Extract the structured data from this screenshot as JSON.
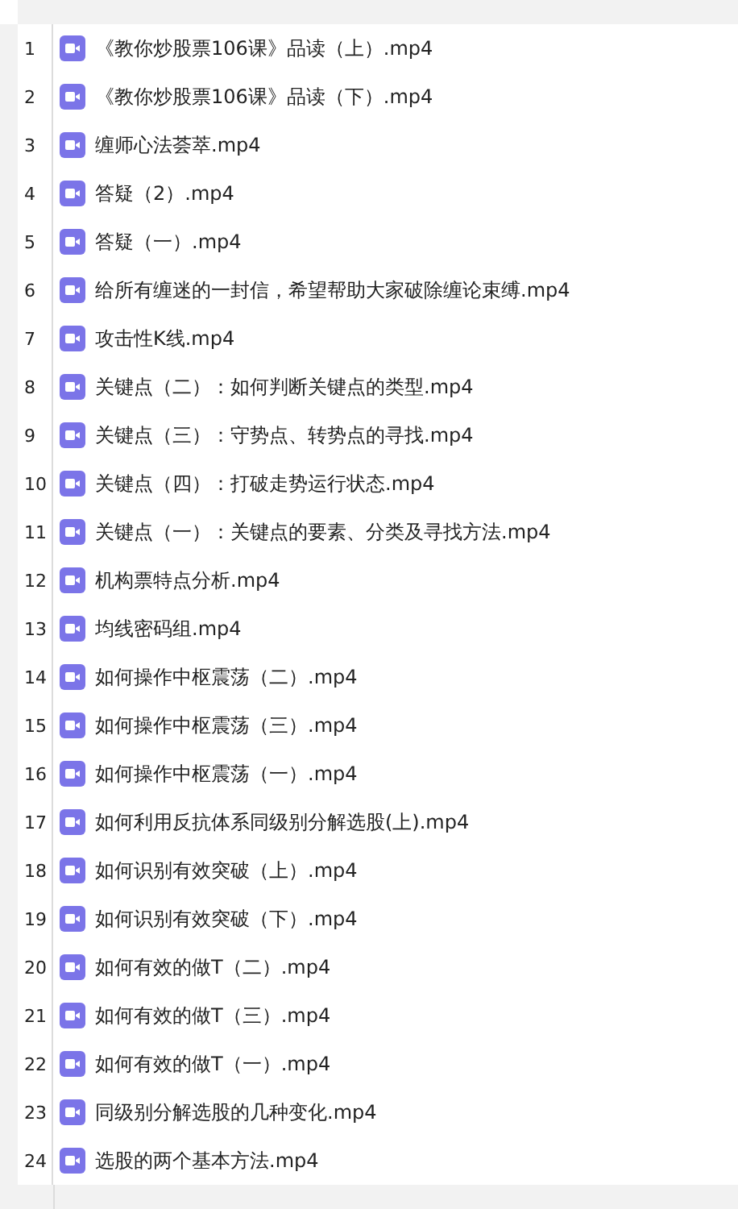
{
  "files": [
    {
      "number": "1",
      "name": "《教你炒股票106课》品读（上）.mp4"
    },
    {
      "number": "2",
      "name": "《教你炒股票106课》品读（下）.mp4"
    },
    {
      "number": "3",
      "name": "缠师心法荟萃.mp4"
    },
    {
      "number": "4",
      "name": "答疑（2）.mp4"
    },
    {
      "number": "5",
      "name": "答疑（一）.mp4"
    },
    {
      "number": "6",
      "name": "给所有缠迷的一封信，希望帮助大家破除缠论束缚.mp4"
    },
    {
      "number": "7",
      "name": "攻击性K线.mp4"
    },
    {
      "number": "8",
      "name": "关键点（二）：如何判断关键点的类型.mp4"
    },
    {
      "number": "9",
      "name": "关键点（三）：守势点、转势点的寻找.mp4"
    },
    {
      "number": "10",
      "name": "关键点（四）：打破走势运行状态.mp4"
    },
    {
      "number": "11",
      "name": "关键点（一）：关键点的要素、分类及寻找方法.mp4"
    },
    {
      "number": "12",
      "name": "机构票特点分析.mp4"
    },
    {
      "number": "13",
      "name": "均线密码组.mp4"
    },
    {
      "number": "14",
      "name": "如何操作中枢震荡（二）.mp4"
    },
    {
      "number": "15",
      "name": "如何操作中枢震荡（三）.mp4"
    },
    {
      "number": "16",
      "name": "如何操作中枢震荡（一）.mp4"
    },
    {
      "number": "17",
      "name": "如何利用反抗体系同级别分解选股(上).mp4"
    },
    {
      "number": "18",
      "name": "如何识别有效突破（上）.mp4"
    },
    {
      "number": "19",
      "name": "如何识别有效突破（下）.mp4"
    },
    {
      "number": "20",
      "name": "如何有效的做T（二）.mp4"
    },
    {
      "number": "21",
      "name": "如何有效的做T（三）.mp4"
    },
    {
      "number": "22",
      "name": "如何有效的做T（一）.mp4"
    },
    {
      "number": "23",
      "name": "同级别分解选股的几种变化.mp4"
    },
    {
      "number": "24",
      "name": "选股的两个基本方法.mp4"
    }
  ]
}
